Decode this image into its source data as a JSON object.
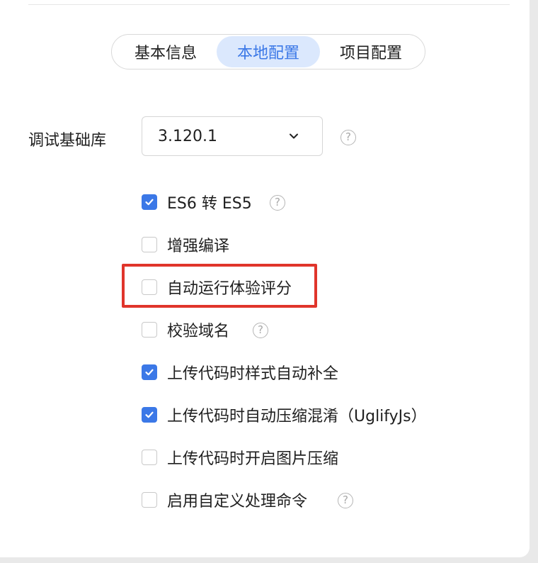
{
  "tabs": {
    "items": [
      {
        "label": "基本信息",
        "active": false
      },
      {
        "label": "本地配置",
        "active": true
      },
      {
        "label": "项目配置",
        "active": false
      }
    ]
  },
  "debug_lib": {
    "label": "调试基础库",
    "value": "3.120.1"
  },
  "options": [
    {
      "label": "ES6 转 ES5",
      "checked": true,
      "help": true
    },
    {
      "label": "增强编译",
      "checked": false,
      "help": false
    },
    {
      "label": "自动运行体验评分",
      "checked": false,
      "help": false,
      "highlighted": true
    },
    {
      "label": "校验域名",
      "checked": false,
      "help": true
    },
    {
      "label": "上传代码时样式自动补全",
      "checked": true,
      "help": false
    },
    {
      "label": "上传代码时自动压缩混淆（UglifyJs）",
      "checked": true,
      "help": false
    },
    {
      "label": "上传代码时开启图片压缩",
      "checked": false,
      "help": false
    },
    {
      "label": "启用自定义处理命令",
      "checked": false,
      "help": true
    }
  ],
  "help_glyph": "?",
  "colors": {
    "accent": "#3b78e7",
    "active_tab_bg": "#dbe8fd",
    "highlight": "#e0352b"
  }
}
